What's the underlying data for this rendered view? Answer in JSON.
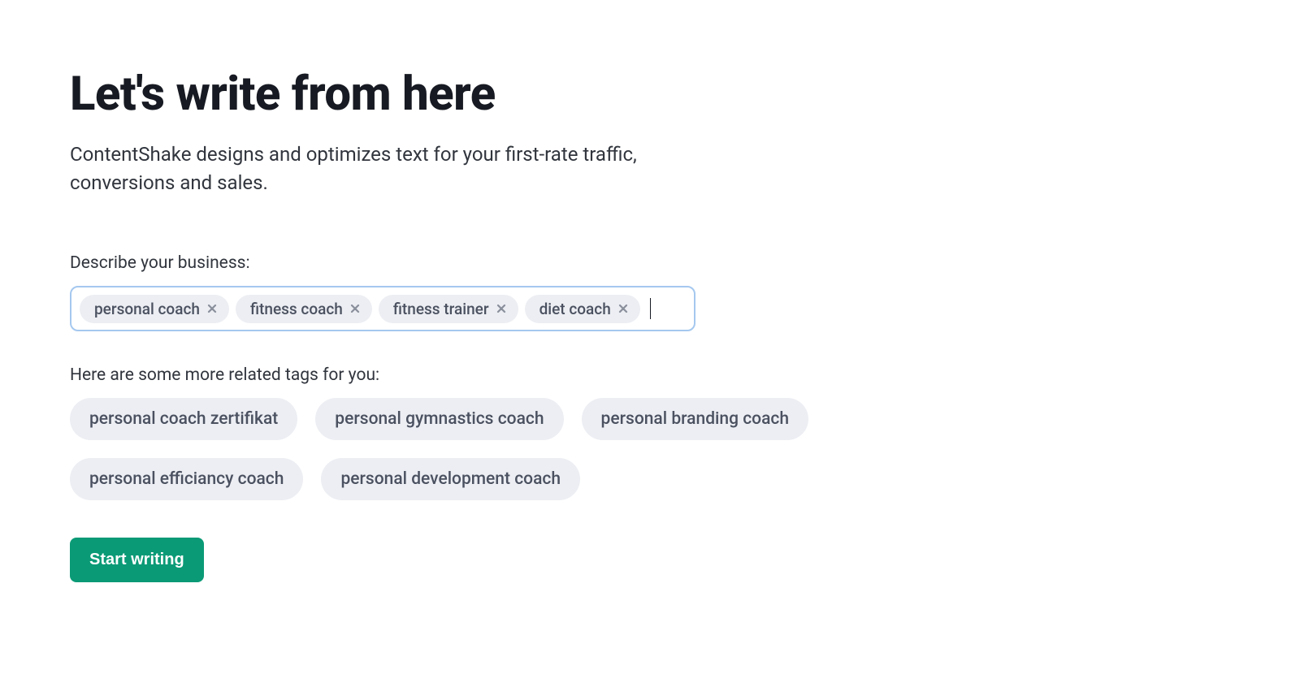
{
  "heading": "Let's write from here",
  "subtitle": "ContentShake designs and optimizes text for your first-rate traffic, conversions and sales.",
  "describe_label": "Describe your business:",
  "tags": [
    "personal coach",
    "fitness coach",
    "fitness trainer",
    "diet coach"
  ],
  "related_label": "Here are some more related tags for you:",
  "suggested_tags": [
    "personal coach zertifikat",
    "personal gymnastics coach",
    "personal branding coach",
    "personal efficiancy coach",
    "personal development coach"
  ],
  "cta": "Start writing",
  "colors": {
    "accent": "#0a9a76",
    "input_border": "#a5c8ef",
    "chip_bg": "#eceef3",
    "text_dark": "#171a22",
    "text_muted": "#4b5160"
  }
}
